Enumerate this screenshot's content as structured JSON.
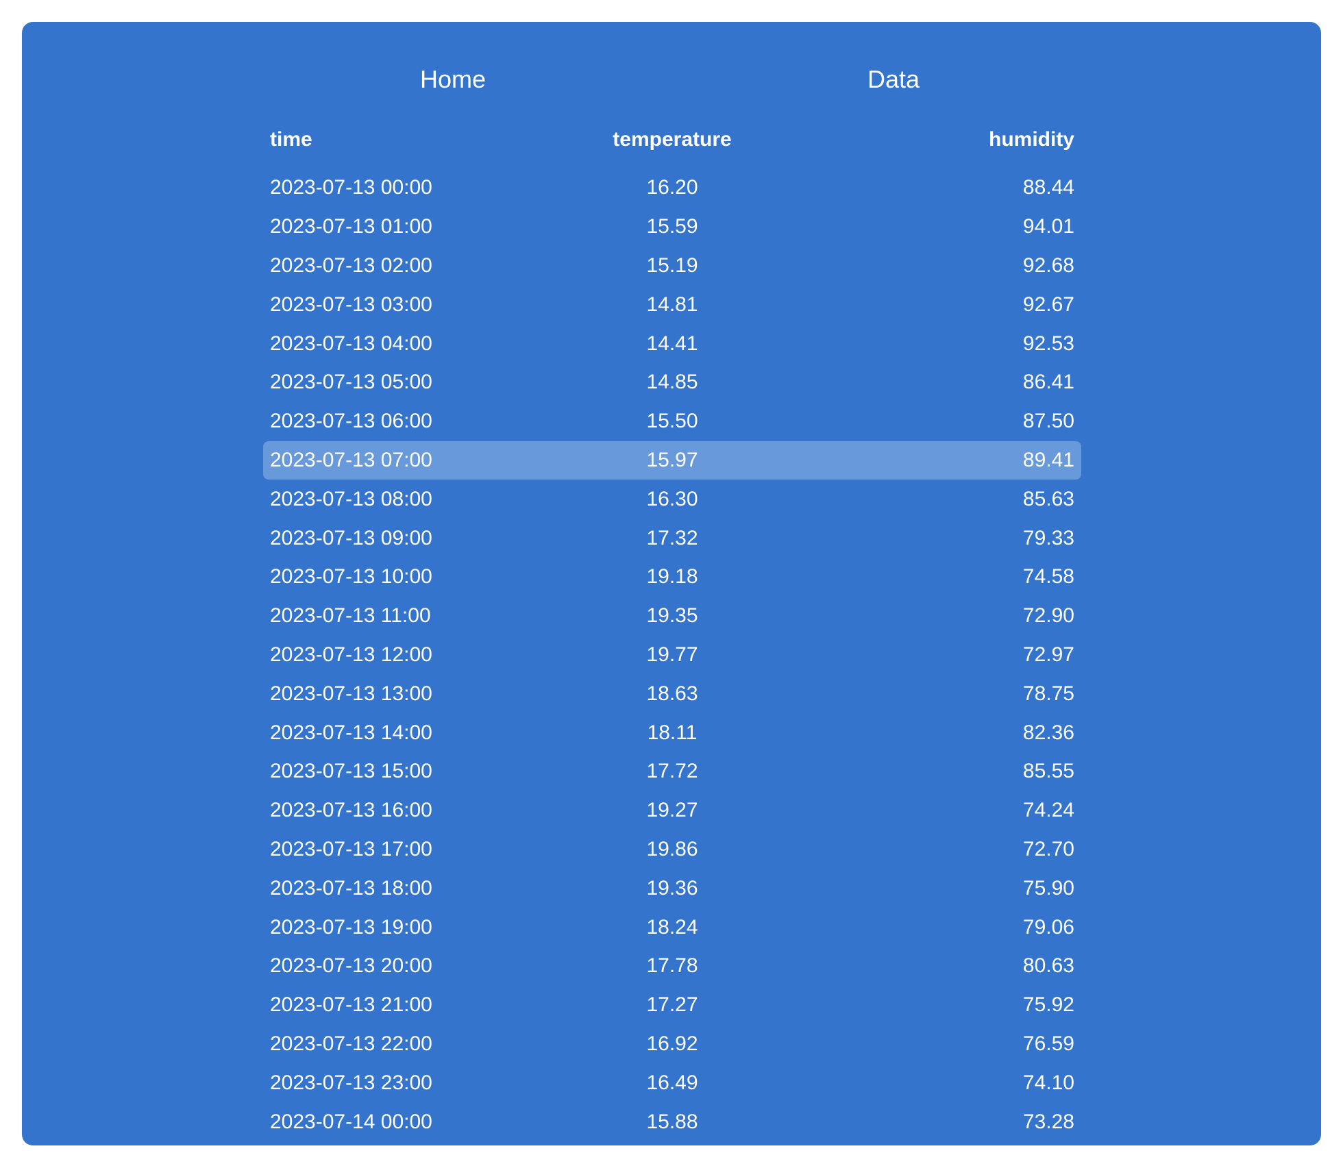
{
  "nav": {
    "home_label": "Home",
    "data_label": "Data"
  },
  "table": {
    "columns": [
      "time",
      "temperature",
      "humidity"
    ],
    "highlighted_row_index": 7,
    "rows": [
      {
        "time": "2023-07-13 00:00",
        "temperature": "16.20",
        "humidity": "88.44"
      },
      {
        "time": "2023-07-13 01:00",
        "temperature": "15.59",
        "humidity": "94.01"
      },
      {
        "time": "2023-07-13 02:00",
        "temperature": "15.19",
        "humidity": "92.68"
      },
      {
        "time": "2023-07-13 03:00",
        "temperature": "14.81",
        "humidity": "92.67"
      },
      {
        "time": "2023-07-13 04:00",
        "temperature": "14.41",
        "humidity": "92.53"
      },
      {
        "time": "2023-07-13 05:00",
        "temperature": "14.85",
        "humidity": "86.41"
      },
      {
        "time": "2023-07-13 06:00",
        "temperature": "15.50",
        "humidity": "87.50"
      },
      {
        "time": "2023-07-13 07:00",
        "temperature": "15.97",
        "humidity": "89.41"
      },
      {
        "time": "2023-07-13 08:00",
        "temperature": "16.30",
        "humidity": "85.63"
      },
      {
        "time": "2023-07-13 09:00",
        "temperature": "17.32",
        "humidity": "79.33"
      },
      {
        "time": "2023-07-13 10:00",
        "temperature": "19.18",
        "humidity": "74.58"
      },
      {
        "time": "2023-07-13 11:00",
        "temperature": "19.35",
        "humidity": "72.90"
      },
      {
        "time": "2023-07-13 12:00",
        "temperature": "19.77",
        "humidity": "72.97"
      },
      {
        "time": "2023-07-13 13:00",
        "temperature": "18.63",
        "humidity": "78.75"
      },
      {
        "time": "2023-07-13 14:00",
        "temperature": "18.11",
        "humidity": "82.36"
      },
      {
        "time": "2023-07-13 15:00",
        "temperature": "17.72",
        "humidity": "85.55"
      },
      {
        "time": "2023-07-13 16:00",
        "temperature": "19.27",
        "humidity": "74.24"
      },
      {
        "time": "2023-07-13 17:00",
        "temperature": "19.86",
        "humidity": "72.70"
      },
      {
        "time": "2023-07-13 18:00",
        "temperature": "19.36",
        "humidity": "75.90"
      },
      {
        "time": "2023-07-13 19:00",
        "temperature": "18.24",
        "humidity": "79.06"
      },
      {
        "time": "2023-07-13 20:00",
        "temperature": "17.78",
        "humidity": "80.63"
      },
      {
        "time": "2023-07-13 21:00",
        "temperature": "17.27",
        "humidity": "75.92"
      },
      {
        "time": "2023-07-13 22:00",
        "temperature": "16.92",
        "humidity": "76.59"
      },
      {
        "time": "2023-07-13 23:00",
        "temperature": "16.49",
        "humidity": "74.10"
      },
      {
        "time": "2023-07-14 00:00",
        "temperature": "15.88",
        "humidity": "73.28"
      }
    ]
  },
  "colors": {
    "panel_background": "#3474cc",
    "highlight_row": "#6899da",
    "text": "#ffffff"
  }
}
